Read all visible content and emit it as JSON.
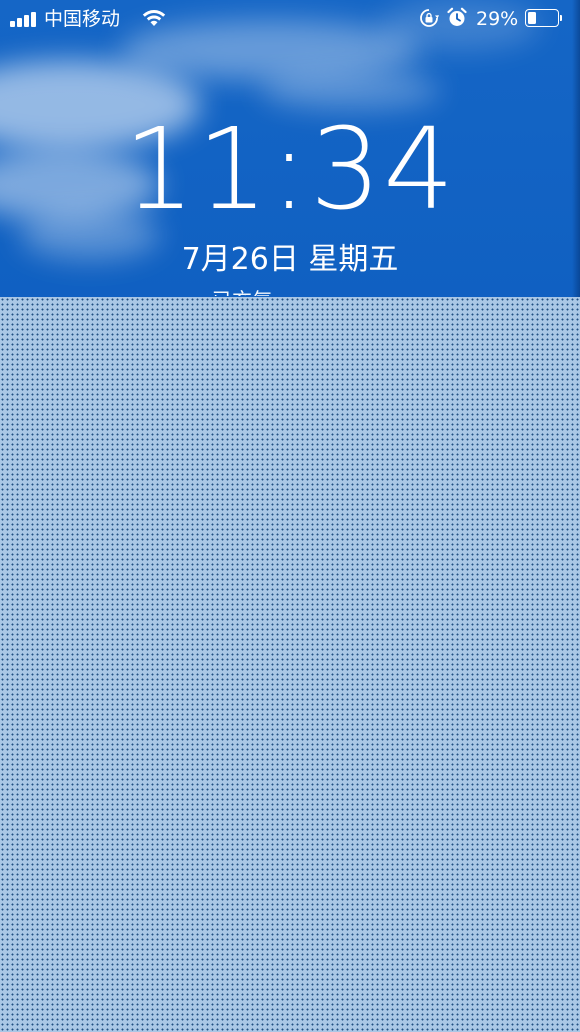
{
  "status_bar": {
    "signal_bars": 4,
    "carrier": "中国移动",
    "wifi_icon": "wifi-icon",
    "rotation_lock_icon": "lock-rotation-icon",
    "alarm_icon": "alarm-icon",
    "battery_percent_label": "29%",
    "battery_level": 0.29
  },
  "lock_screen": {
    "time": "11:34",
    "date": "7月26日 星期五",
    "notification_peek": "已充气"
  },
  "colors": {
    "sky": "#0e5ec0",
    "text": "#ffffff",
    "redaction": "#a9c7e6"
  }
}
